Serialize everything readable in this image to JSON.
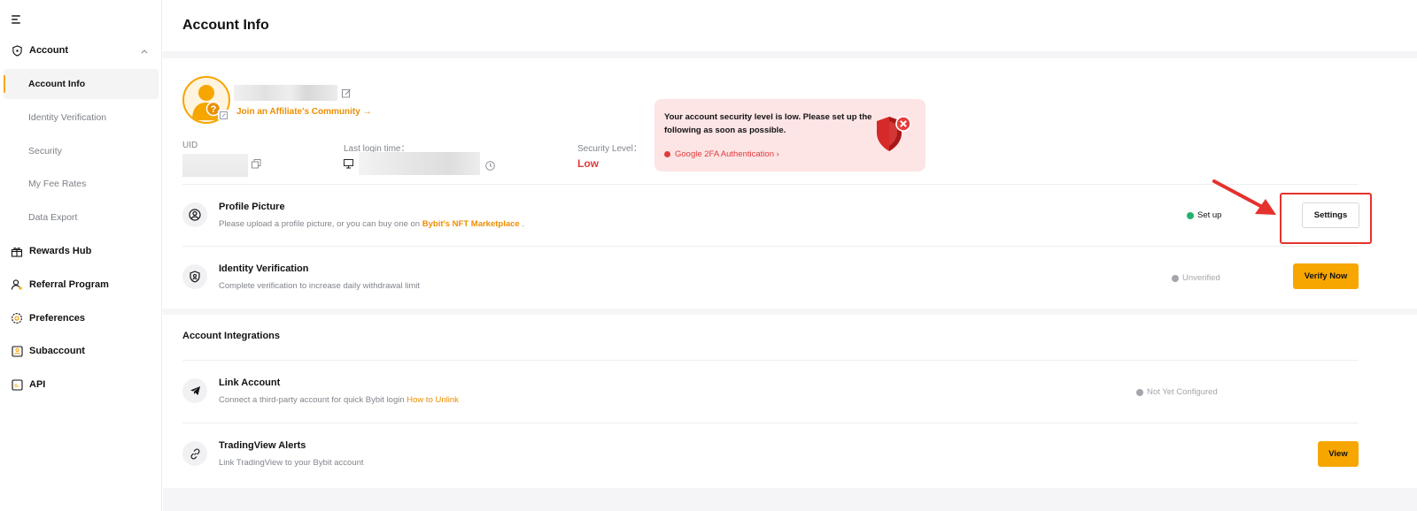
{
  "sidebar": {
    "account": "Account",
    "sub_items": [
      "Account Info",
      "Identity Verification",
      "Security",
      "My Fee Rates",
      "Data Export"
    ],
    "items": [
      "Rewards Hub",
      "Referral Program",
      "Preferences",
      "Subaccount",
      "API"
    ]
  },
  "page": {
    "title": "Account Info"
  },
  "profile": {
    "affiliate_link": "Join an Affiliate's Community →",
    "uid_label": "UID",
    "last_login_label": "Last login time：",
    "security_level_label": "Security Level：",
    "security_level": "Low"
  },
  "security_tip": {
    "message": "Your account security level is low. Please set up the following as soon as possible.",
    "link": "Google 2FA Authentication ›"
  },
  "rows": {
    "profile_picture": {
      "title": "Profile Picture",
      "desc_prefix": "Please upload a profile picture, or you can buy one on ",
      "desc_link": "Bybit's NFT Marketplace",
      "desc_suffix": " .",
      "status": "Set up",
      "button": "Settings"
    },
    "identity": {
      "title": "Identity Verification",
      "desc": "Complete verification to increase daily withdrawal limit",
      "status": "Unverified",
      "button": "Verify Now"
    }
  },
  "integrations": {
    "title": "Account Integrations",
    "link_account": {
      "title": "Link Account",
      "desc_prefix": "Connect a third-party account for quick Bybit login ",
      "desc_link": "How to Unlink",
      "status": "Not Yet Configured"
    },
    "tradingview": {
      "title": "TradingView Alerts",
      "desc": "Link TradingView to your Bybit account",
      "button": "View"
    }
  },
  "colors": {
    "brand": "#f7a600",
    "link": "#ee8e00",
    "danger": "#e23b3b",
    "success": "#20b26c"
  }
}
